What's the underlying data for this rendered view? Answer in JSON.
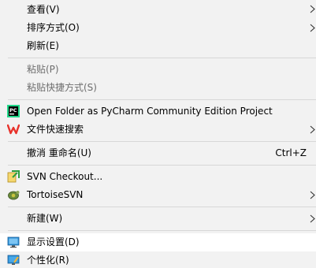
{
  "menu": {
    "view": "查看(V)",
    "sort": "排序方式(O)",
    "refresh": "刷新(E)",
    "paste": "粘贴(P)",
    "paste_shortcut": "粘贴快捷方式(S)",
    "pycharm": "Open Folder as PyCharm Community Edition Project",
    "wps_search": "文件快速搜索",
    "undo_rename": "撤消 重命名(U)",
    "undo_shortcut": "Ctrl+Z",
    "svn_checkout": "SVN Checkout...",
    "tortoisesvn": "TortoiseSVN",
    "new": "新建(W)",
    "display_settings": "显示设置(D)",
    "personalize": "个性化(R)"
  },
  "icons": {
    "pycharm": "pycharm-icon",
    "wps": "wps-icon",
    "svn_checkout": "svn-checkout-icon",
    "tortoisesvn": "tortoisesvn-icon",
    "display": "display-settings-icon",
    "personalize": "personalize-icon"
  },
  "colors": {
    "background": "#f2f2f2",
    "hover": "#ffffff",
    "disabled_text": "#6d6d6d",
    "separator": "#d7d7d7",
    "wps_red": "#e8322b",
    "pycharm_green": "#21d789"
  }
}
